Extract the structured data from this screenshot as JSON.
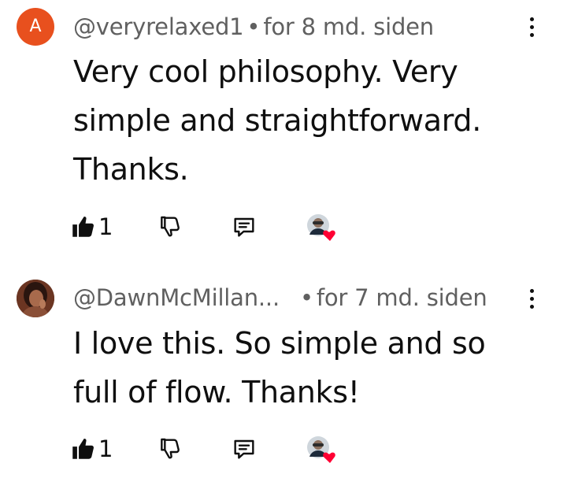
{
  "comments": [
    {
      "avatar_letter": "A",
      "author": "@veryrelaxed1",
      "separator": "•",
      "time": "for 8 md. siden",
      "text": "Very cool philosophy.  Very simple and straightforward. Thanks.",
      "like_count": "1"
    },
    {
      "author": "@DawnMcMillan...",
      "separator": "•",
      "time": "for 7 md. siden",
      "text": "I love this. So simple and so full of flow. Thanks!",
      "like_count": "1"
    }
  ],
  "icons": {
    "like": "thumbs-up-icon",
    "dislike": "thumbs-down-icon",
    "reply": "reply-comment-icon",
    "more": "vertical-ellipsis-icon",
    "heart": "creator-heart-icon"
  },
  "colors": {
    "avatar_letter_bg": "#e8501e",
    "meta_text": "#606060",
    "heart": "#ff0033"
  }
}
